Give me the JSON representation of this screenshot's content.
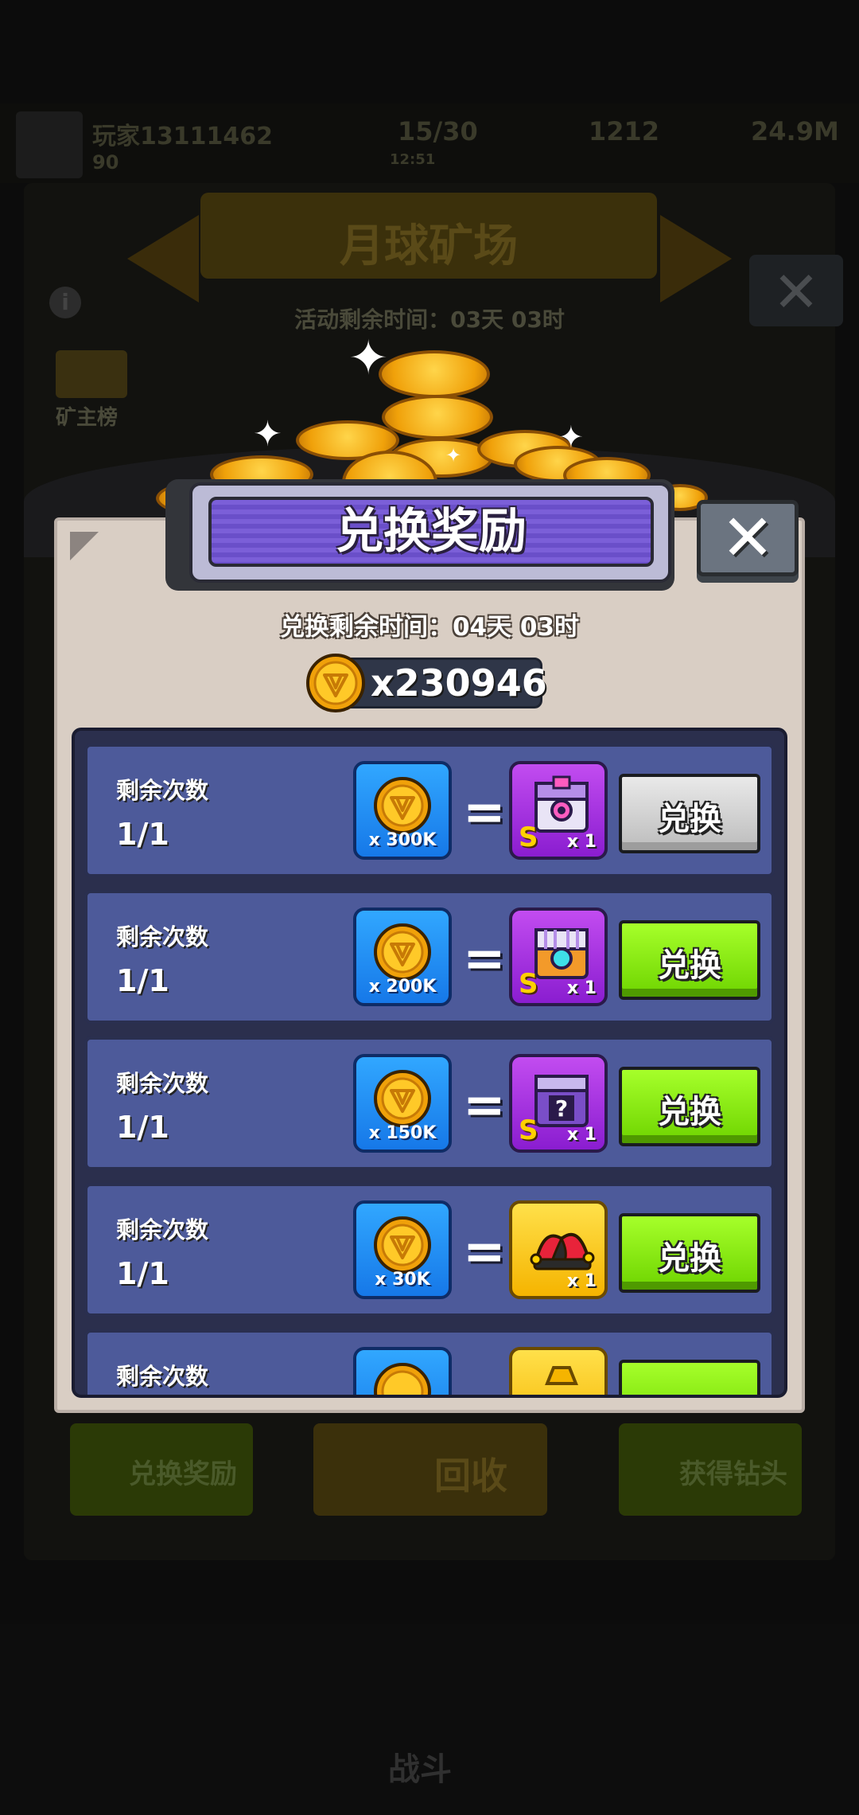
{
  "background": {
    "player_name": "玩家13111462",
    "player_level": "90",
    "energy": "15/30",
    "energy_timer": "12:51",
    "gems": "1212",
    "gold": "24.9M",
    "event_title": "月球矿场",
    "event_timer": "活动剩余时间：03天 03时",
    "leaderboard_label": "矿主榜",
    "bottom_buttons": [
      "兑换奖励",
      "回收",
      "获得钻头"
    ],
    "battle_label": "战斗"
  },
  "dialog": {
    "title": "兑换奖励",
    "countdown": "兑换剩余时间：04天 03时",
    "balance": "x230946",
    "close_symbol": "✕"
  },
  "rows": [
    {
      "label": "剩余次数",
      "count": "1/1",
      "cost": "x 300K",
      "reward_icon": "s-chest-pink-gem-icon",
      "reward_qty": "x 1",
      "grade": "S",
      "button": "兑换",
      "button_state": "disabled"
    },
    {
      "label": "剩余次数",
      "count": "1/1",
      "cost": "x 200K",
      "reward_icon": "s-chest-cyan-gem-icon",
      "reward_qty": "x 1",
      "grade": "S",
      "button": "兑换",
      "button_state": "enabled"
    },
    {
      "label": "剩余次数",
      "count": "1/1",
      "cost": "x 150K",
      "reward_icon": "s-mystery-chest-icon",
      "reward_qty": "x 1",
      "grade": "S",
      "button": "兑换",
      "button_state": "enabled"
    },
    {
      "label": "剩余次数",
      "count": "1/1",
      "cost": "x 30K",
      "reward_icon": "jester-hat-icon",
      "reward_qty": "x 1",
      "grade": "",
      "button": "兑换",
      "button_state": "enabled"
    },
    {
      "label": "剩余次数",
      "count": "",
      "cost": "",
      "reward_icon": "gold-item-icon",
      "reward_qty": "",
      "grade": "",
      "button": "",
      "button_state": "enabled"
    }
  ],
  "colors": {
    "button_green": "#7ee000",
    "button_gray": "#cfcfcf",
    "row_bg": "#4d5a9a",
    "dialog_bg": "#d9cec4",
    "title_purple": "#6f55cf"
  }
}
